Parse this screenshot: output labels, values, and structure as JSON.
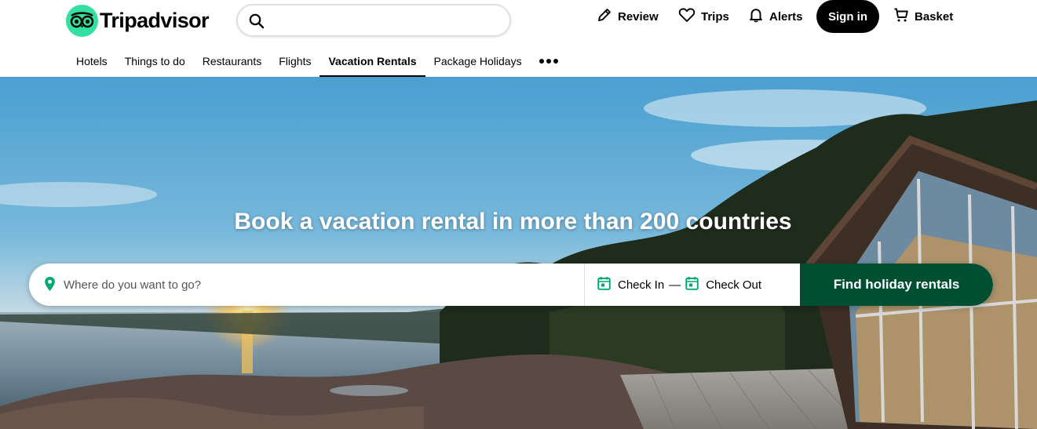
{
  "brand": {
    "name": "Tripadvisor",
    "accent": "#34e0a1",
    "logo_icon": "owl-eyes-icon"
  },
  "header": {
    "search": {
      "value": "",
      "placeholder": "",
      "icon": "search-icon"
    },
    "actions": [
      {
        "label": "Review",
        "icon": "pencil-icon"
      },
      {
        "label": "Trips",
        "icon": "heart-icon"
      },
      {
        "label": "Alerts",
        "icon": "bell-icon"
      },
      {
        "label": "Basket",
        "icon": "cart-icon"
      }
    ],
    "signin_label": "Sign in"
  },
  "tabs": [
    {
      "label": "Hotels",
      "active": false
    },
    {
      "label": "Things to do",
      "active": false
    },
    {
      "label": "Restaurants",
      "active": false
    },
    {
      "label": "Flights",
      "active": false
    },
    {
      "label": "Vacation Rentals",
      "active": true
    },
    {
      "label": "Package Holidays",
      "active": false
    }
  ],
  "more_tabs_icon": "more-dots-icon",
  "hero": {
    "title": "Book a vacation rental in more than 200 countries",
    "search": {
      "where_placeholder": "Where do you want to go?",
      "where_value": "",
      "check_in": "Check In",
      "date_separator": "—",
      "check_out": "Check Out",
      "button": "Find holiday rentals",
      "button_color": "#004f32",
      "date_icon_color": "#00aa6c"
    }
  }
}
